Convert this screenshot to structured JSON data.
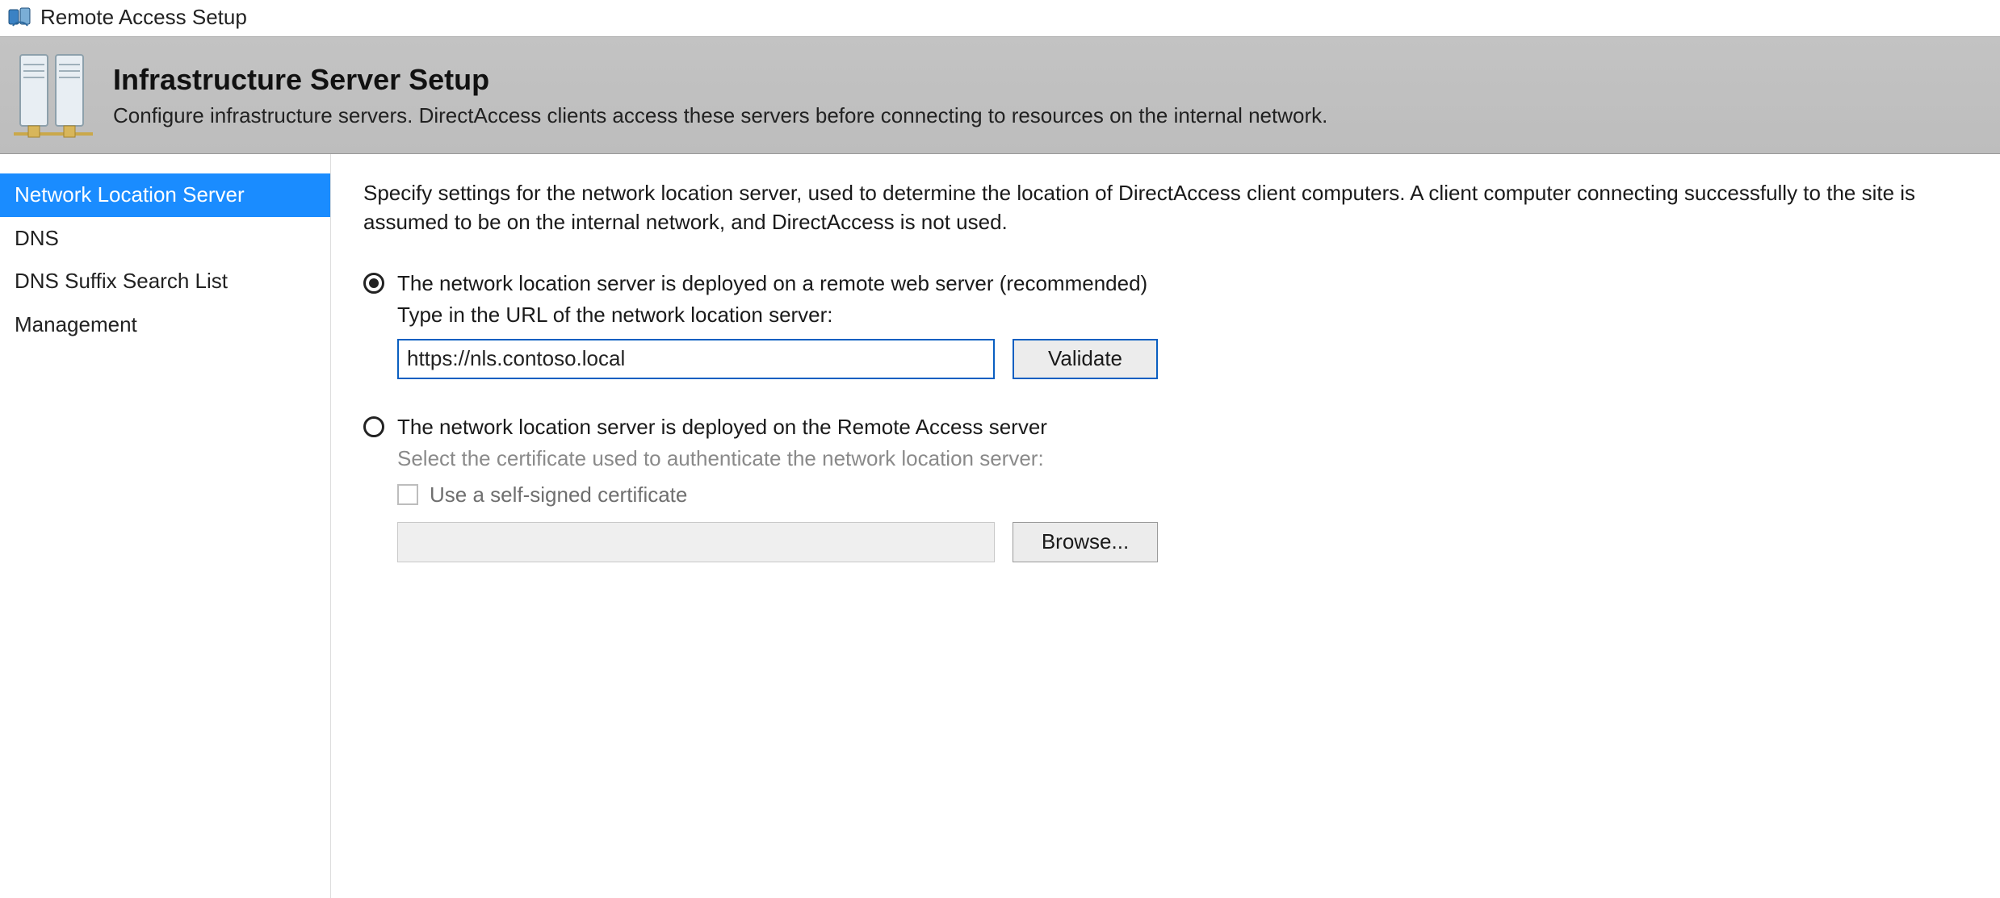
{
  "window": {
    "title": "Remote Access Setup"
  },
  "banner": {
    "heading": "Infrastructure Server Setup",
    "subtitle": "Configure infrastructure servers. DirectAccess clients access these servers before connecting to resources on the internal network."
  },
  "sidebar": {
    "items": [
      {
        "label": "Network Location Server",
        "selected": true
      },
      {
        "label": "DNS",
        "selected": false
      },
      {
        "label": "DNS Suffix Search List",
        "selected": false
      },
      {
        "label": "Management",
        "selected": false
      }
    ]
  },
  "content": {
    "intro": "Specify settings for the network location server, used to determine the location of DirectAccess client computers. A client computer connecting successfully to the site is assumed to be on the internal network, and DirectAccess is not used.",
    "option_remote": {
      "label": "The network location server is deployed on a remote web server (recommended)",
      "checked": true,
      "url_prompt": "Type in the URL of the network location server:",
      "url_value": "https://nls.contoso.local",
      "validate_label": "Validate"
    },
    "option_local": {
      "label": "The network location server is deployed on the Remote Access server",
      "checked": false,
      "cert_prompt": "Select the certificate used to authenticate the network location server:",
      "self_signed_label": "Use a self-signed certificate",
      "self_signed_checked": false,
      "cert_value": "",
      "browse_label": "Browse..."
    }
  }
}
